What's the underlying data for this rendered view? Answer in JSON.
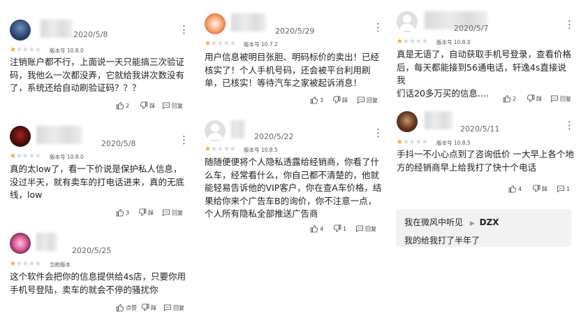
{
  "reviews": [
    {
      "date": "2020/5/8",
      "rating": 1,
      "version": "版本号 10.8.0",
      "lines": [
        "注销账户都不行，上面说一天只能搞三次验证",
        "码，我他么一次都没弄，它就给我讲次数没有",
        "了，系统还给自动刷验证码？？？"
      ],
      "likes": "2",
      "dislike": "踩",
      "reply": "回复"
    },
    {
      "date": "2020/5/8",
      "rating": 1,
      "version": "版本号 10.8.0",
      "lines": [
        "真的太low了，看一下价说是保护私人信息，",
        "没过半天，就有卖车的打电话进来，真的无底",
        "线，low"
      ],
      "likes": "3",
      "dislike": "踩",
      "reply": "回复"
    },
    {
      "date": "2020/5/25",
      "rating": 1,
      "version": "当前版本",
      "lines": [
        "这个软件会把你的信息提供给4s店，只要你用",
        "手机号登陆，卖车的就会不停的骚扰你"
      ],
      "likes": "点赞",
      "dislike": "踩",
      "reply": "回复"
    },
    {
      "date": "2020/5/29",
      "rating": 1,
      "version": "版本号 10.7.2",
      "lines": [
        "用户信息被明目张胆、明码标价的卖出！已经",
        "核实了！个人手机号码，还会被平台利用刷",
        "单，已核实！等待汽车之家被起诉消息！"
      ],
      "likes": "3",
      "dislike": "踩",
      "reply": "回复"
    },
    {
      "date": "2020/5/22",
      "rating": 1,
      "version": "版本号 10.8.5",
      "lines": [
        "随随便便将个人隐私透露给经销商，你看了什",
        "么车，经常看什么，你自己都不清楚的，他就",
        "能轻易告诉他的VIP客户，你在查A车价格，结",
        "果给你来个广告车B的询价，你不注意一点，",
        "个人所有隐私全部推送广告商"
      ],
      "likes": "4",
      "dislike": "1",
      "reply": "回复"
    },
    {
      "date": "2020/5/7",
      "rating": 1,
      "version": "版本号 10.8.0",
      "lines": [
        "真是无语了，自动获取手机号登录，查看价格",
        "后，每天都能接到56通电话，轩逸4s直接说我",
        "们话20多万买的信息...."
      ],
      "likes": "2",
      "dislike": "踩",
      "reply": "回复"
    },
    {
      "date": "2020/5/11",
      "rating": 1,
      "version": "版本号 10.8.5",
      "lines": [
        "手抖一不小心点到了咨询低价 一大早上各个地",
        "方的经销商早上给我打了快十个电话"
      ],
      "likes": "4",
      "dislike": "踩",
      "reply": "1"
    }
  ],
  "reply_box": {
    "author": "我在微风中听见",
    "target": "DZX",
    "text": "我的给我打了半年了"
  },
  "colors": {
    "star_on": "#f5a623",
    "star_off": "#d8d8d8"
  }
}
